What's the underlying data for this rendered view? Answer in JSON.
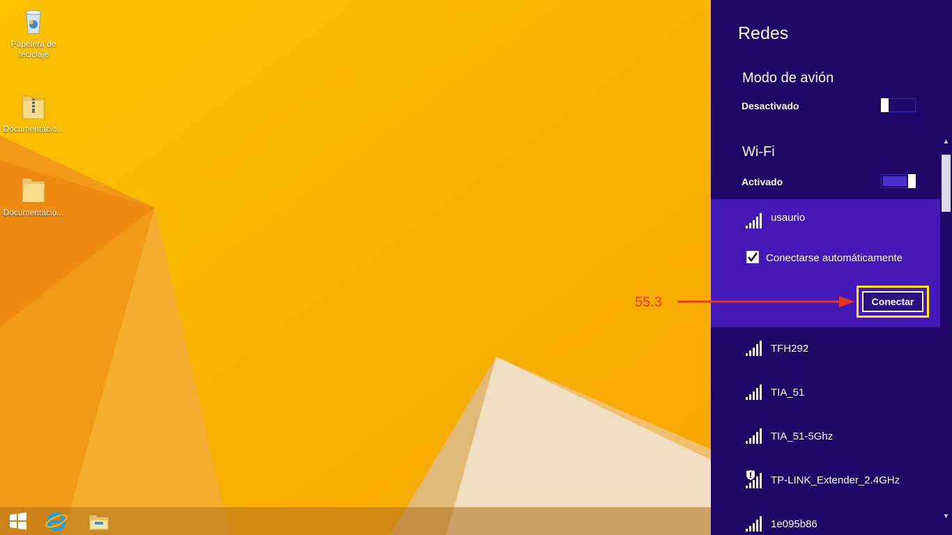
{
  "desktop": {
    "icons": [
      {
        "label": "Papelera de reciclaje",
        "icon": "recycle-bin-icon"
      },
      {
        "label": "Documentacio...",
        "icon": "zip-folder-icon"
      },
      {
        "label": "Documentacio...",
        "icon": "folder-icon"
      }
    ]
  },
  "taskbar": {
    "items": [
      {
        "icon": "windows-start-icon"
      },
      {
        "icon": "internet-explorer-icon"
      },
      {
        "icon": "file-explorer-icon"
      }
    ]
  },
  "charm": {
    "title": "Redes",
    "airplane": {
      "title": "Modo de avión",
      "state": "Desactivado",
      "on": false
    },
    "wifi": {
      "title": "Wi-Fi",
      "state": "Activado",
      "on": true
    },
    "selected_network": {
      "name": "usaurio",
      "auto_connect_label": "Conectarse automáticamente",
      "auto_connect_checked": true,
      "connect_label": "Conectar"
    },
    "networks": [
      {
        "name": "TFH292",
        "secured_warning": false
      },
      {
        "name": "TIA_51",
        "secured_warning": false
      },
      {
        "name": "TIA_51-5Ghz",
        "secured_warning": false
      },
      {
        "name": "TP-LINK_Extender_2.4GHz",
        "secured_warning": true
      },
      {
        "name": "1e095b86",
        "secured_warning": false
      }
    ]
  },
  "annotation": {
    "label": "55.3",
    "color": "#e8361b"
  },
  "colors": {
    "charm_bg": "#1f0768",
    "selected_bg": "#4519b8",
    "highlight": "#ffea00",
    "desktop_bg": "#f7b800"
  }
}
